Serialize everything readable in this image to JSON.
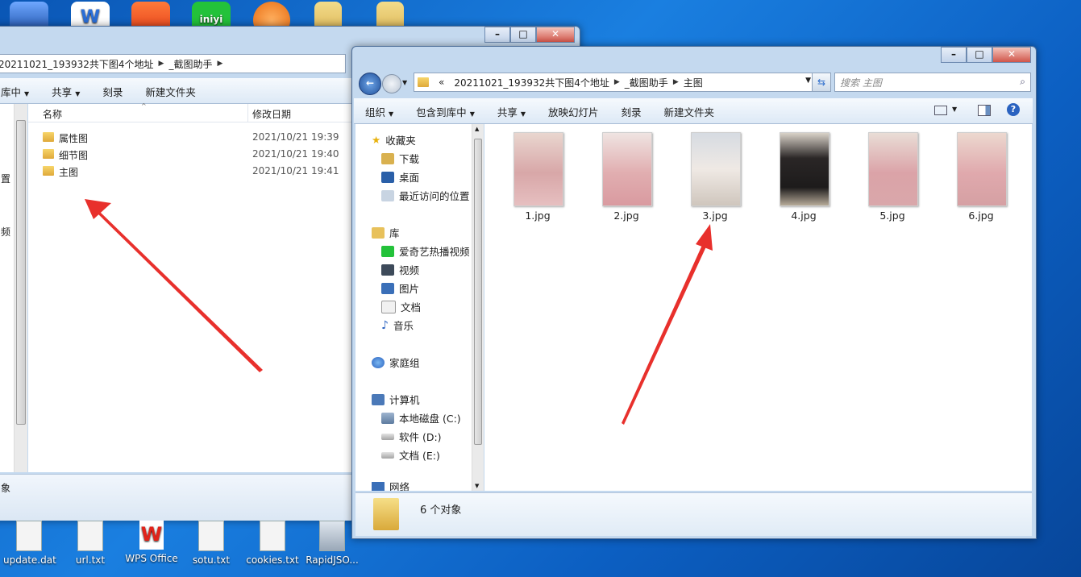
{
  "desktop": {
    "bottom_icons": [
      "update.dat",
      "url.txt",
      "WPS Office",
      "sotu.txt",
      "cookies.txt",
      "RapidJSO..."
    ],
    "top_icon_text": "iniyi"
  },
  "left_window": {
    "address": {
      "part1": "20211021_193932共下图4个地址",
      "part2": "_截图助手"
    },
    "toolbar": {
      "include_library": "库中",
      "share": "共享",
      "burn": "刻录",
      "new_folder": "新建文件夹"
    },
    "columns": {
      "name": "名称",
      "modified": "修改日期"
    },
    "sidebar_partial": {
      "a": "置",
      "b": "频"
    },
    "rows": [
      {
        "name": "属性图",
        "date": "2021/10/21 19:39"
      },
      {
        "name": "细节图",
        "date": "2021/10/21 19:40"
      },
      {
        "name": "主图",
        "date": "2021/10/21 19:41"
      }
    ],
    "status_partial": "象"
  },
  "right_window": {
    "address": {
      "chevron": "«",
      "part1": "20211021_193932共下图4个地址",
      "part2": "_截图助手",
      "part3": "主图"
    },
    "search_placeholder": "搜索 主图",
    "toolbar": {
      "organize": "组织",
      "include_library": "包含到库中",
      "share": "共享",
      "slideshow": "放映幻灯片",
      "burn": "刻录",
      "new_folder": "新建文件夹"
    },
    "nav": {
      "favorites": "收藏夹",
      "downloads": "下载",
      "desktop": "桌面",
      "recent": "最近访问的位置",
      "libraries": "库",
      "iqiyi": "爱奇艺热播视频",
      "videos": "视频",
      "pictures": "图片",
      "documents": "文档",
      "music": "音乐",
      "homegroup": "家庭组",
      "computer": "计算机",
      "drive_c": "本地磁盘 (C:)",
      "drive_d": "软件 (D:)",
      "drive_e": "文档 (E:)",
      "network": "网络"
    },
    "files": [
      "1.jpg",
      "2.jpg",
      "3.jpg",
      "4.jpg",
      "5.jpg",
      "6.jpg"
    ],
    "status": "6 个对象"
  },
  "colors": {
    "arrow": "#e8302c",
    "desktop": "#1a7fe0"
  }
}
